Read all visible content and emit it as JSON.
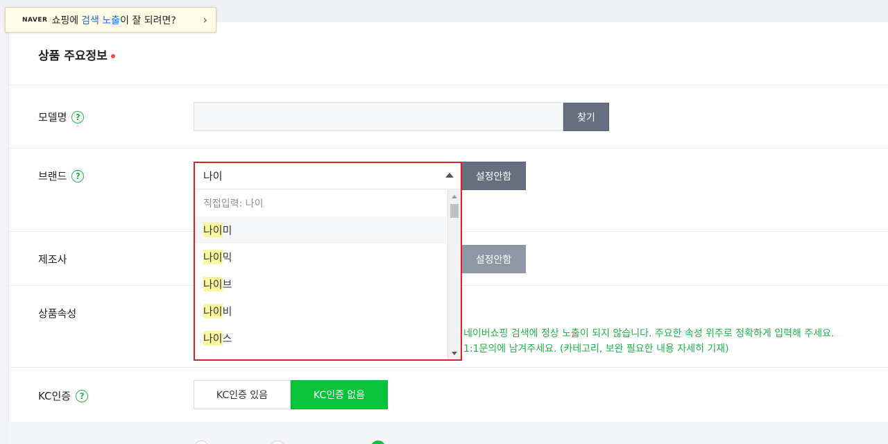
{
  "banner": {
    "brand": "NAVER",
    "text1": "쇼핑에",
    "text2": "검색 노출",
    "text3": "이 잘 되려면?",
    "chevron": "›"
  },
  "section": {
    "title": "상품 주요정보"
  },
  "model": {
    "label": "모델명",
    "value": "",
    "button": "찾기"
  },
  "brand": {
    "label": "브랜드",
    "input_value": "나이",
    "button": "설정안함",
    "hint": "직접입력: 나이",
    "items": [
      {
        "match": "나이",
        "rest": "미"
      },
      {
        "match": "나이",
        "rest": "믹"
      },
      {
        "match": "나이",
        "rest": "브"
      },
      {
        "match": "나이",
        "rest": "비"
      },
      {
        "match": "나이",
        "rest": "스"
      }
    ]
  },
  "manufacturer": {
    "label": "제조사",
    "button": "설정안함"
  },
  "attributes": {
    "label": "상품속성",
    "note1": "네이버쇼핑 검색에 정상 노출이 되지 않습니다. 주요한 속성 위주로 정확하게 입력해 주세요.",
    "note2": "1:1문의에 남겨주세요. (카테고리, 보완 필요한 내용 자세히 기재)"
  },
  "kc": {
    "label": "KC인증",
    "yes": "KC인증 있음",
    "no": "KC인증 없음"
  },
  "colors": {
    "accent": "#08c43b",
    "highlight": "#fbf7a1",
    "error": "#e01e25"
  }
}
